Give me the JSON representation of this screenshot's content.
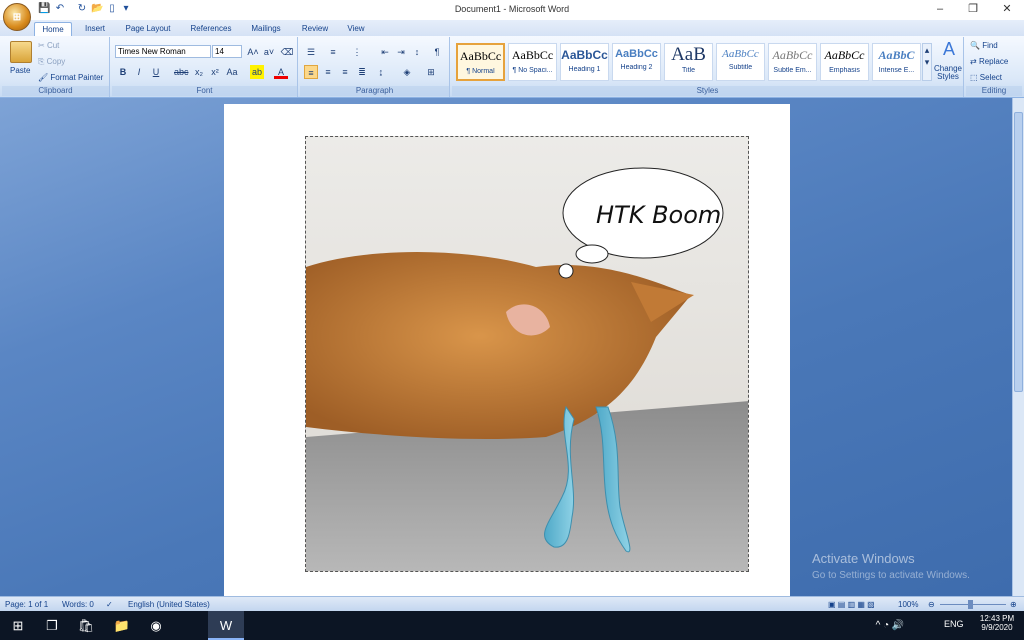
{
  "window": {
    "title": "Document1 - Microsoft Word",
    "office_button": "Office"
  },
  "tabs": [
    "Home",
    "Insert",
    "Page Layout",
    "References",
    "Mailings",
    "Review",
    "View"
  ],
  "ribbon": {
    "clipboard": {
      "label": "Clipboard",
      "paste": "Paste",
      "cut": "Cut",
      "copy": "Copy",
      "format_painter": "Format Painter"
    },
    "font": {
      "label": "Font",
      "family": "Times New Roman",
      "size": "14"
    },
    "paragraph": {
      "label": "Paragraph"
    },
    "styles": {
      "label": "Styles",
      "items": [
        {
          "sample": "AaBbCc",
          "name": "¶ Normal"
        },
        {
          "sample": "AaBbCc",
          "name": "¶ No Spaci..."
        },
        {
          "sample": "AaBbCc",
          "name": "Heading 1"
        },
        {
          "sample": "AaBbCc",
          "name": "Heading 2"
        },
        {
          "sample": "AaB",
          "name": "Title"
        },
        {
          "sample": "AaBbCc",
          "name": "Subtitle"
        },
        {
          "sample": "AaBbCc",
          "name": "Subtle Em..."
        },
        {
          "sample": "AaBbCc",
          "name": "Emphasis"
        },
        {
          "sample": "AaBbC",
          "name": "Intense E..."
        }
      ],
      "change_styles": "Change Styles"
    },
    "editing": {
      "label": "Editing",
      "find": "Find",
      "replace": "Replace",
      "select": "Select"
    }
  },
  "document": {
    "handwritten_text": "HTK Boom"
  },
  "status": {
    "page": "Page: 1 of 1",
    "words": "Words: 0",
    "language": "English (United States)",
    "zoom": "100%"
  },
  "watermark": {
    "line1": "Activate Windows",
    "line2": "Go to Settings to activate Windows."
  },
  "taskbar": {
    "language": "ENG",
    "time": "12:43 PM",
    "date": "9/9/2020"
  },
  "colors": {
    "ribbon_bg": "#dbe8f8",
    "workspace": "#4a78b8",
    "accent": "#15428b",
    "taskbar": "#0c1524"
  }
}
